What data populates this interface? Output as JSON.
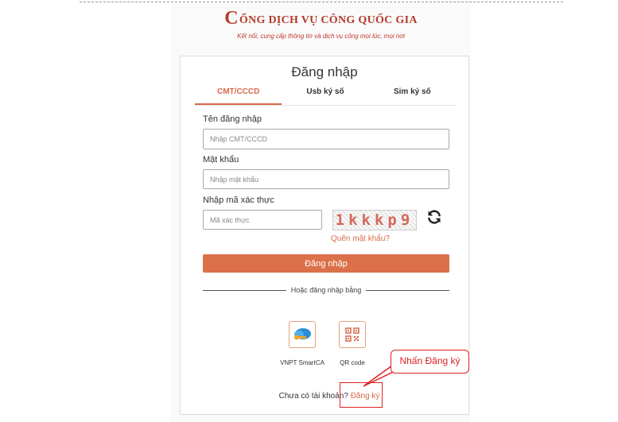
{
  "brand": {
    "title_initial": "C",
    "title_rest": "ỔNG DỊCH VỤ CÔNG QUỐC GIA",
    "subtitle": "Kết nối, cung cấp thông tin và dịch vụ công mọi lúc, mọi nơi"
  },
  "login": {
    "title": "Đăng nhập",
    "tabs": [
      {
        "label": "CMT/CCCD",
        "active": true
      },
      {
        "label": "Usb ký số",
        "active": false
      },
      {
        "label": "Sim ký số",
        "active": false
      }
    ],
    "username_label": "Tên đăng nhập",
    "username_placeholder": "Nhập CMT/CCCD",
    "password_label": "Mật khẩu",
    "password_placeholder": "Nhập mật khẩu",
    "captcha_label": "Nhập mã xác thực",
    "captcha_placeholder": "Mã xác thực",
    "captcha_text": "1kkkp9",
    "forgot_password": "Quên mật khẩu?",
    "submit": "Đăng nhập",
    "alt_login_text": "Hoặc đăng nhập bằng",
    "methods": [
      {
        "label": "VNPT SmartCA",
        "icon": "vnpt-smartca-icon"
      },
      {
        "label": "QR code",
        "icon": "qr-code-icon"
      }
    ],
    "no_account_text": "Chưa có tài khoản?",
    "signup_link": "Đăng ký"
  },
  "annotation": {
    "callout_text": "Nhấn Đăng ký"
  },
  "colors": {
    "accent": "#dc7048",
    "brand_red": "#b43a2a",
    "annotation_red": "#e02020"
  }
}
